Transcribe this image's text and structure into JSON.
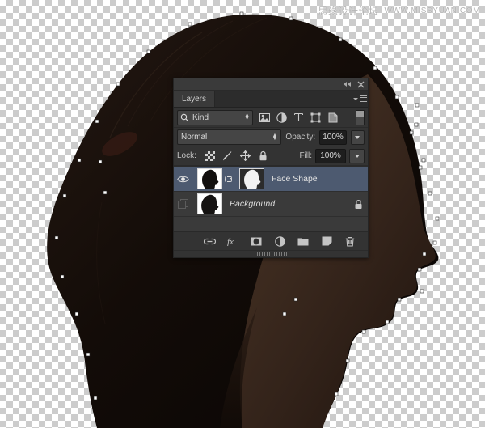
{
  "watermark": {
    "site_cn": "思缘设计论坛",
    "site_url": "WWW.MISSYUAN.COM"
  },
  "canvas": {
    "artwork_name": "woman-head-profile-silhouette",
    "transparency_checker": true,
    "path_selection_visible": true
  },
  "layers_panel": {
    "tab_label": "Layers",
    "titlebar": {
      "collapse_label": "◀◀",
      "close_label": "✕"
    },
    "menu_label": "panel-menu",
    "filter": {
      "kind_label": "Kind",
      "icons": [
        "pixel-layer-filter-icon",
        "adjustment-layer-filter-icon",
        "type-layer-filter-icon",
        "shape-layer-filter-icon",
        "smart-object-filter-icon"
      ],
      "toggle_on": true
    },
    "blend": {
      "mode": "Normal",
      "opacity_label": "Opacity:",
      "opacity_value": "100%"
    },
    "lock": {
      "label": "Lock:",
      "icons": [
        "lock-transparent-pixels-icon",
        "lock-image-pixels-icon",
        "lock-position-icon",
        "lock-all-icon"
      ],
      "fill_label": "Fill:",
      "fill_value": "100%"
    },
    "layers": [
      {
        "name": "Face Shape",
        "visible": true,
        "selected": true,
        "has_mask": true,
        "linked": true,
        "locked": false,
        "italic": false
      },
      {
        "name": "Background",
        "visible": false,
        "selected": false,
        "has_mask": false,
        "linked": false,
        "locked": true,
        "italic": true
      }
    ],
    "bottom_toolbar": [
      "link-layers-icon",
      "layer-style-fx-icon",
      "add-layer-mask-icon",
      "new-adjustment-layer-icon",
      "new-group-icon",
      "new-layer-icon",
      "delete-layer-icon"
    ]
  },
  "colors": {
    "panel_bg": "#333333",
    "list_bg": "#3a3a3a",
    "selected_row": "#4d5a70",
    "text": "#c8c8c8",
    "field_bg": "#454545",
    "value_bg": "#1e1e1e"
  }
}
